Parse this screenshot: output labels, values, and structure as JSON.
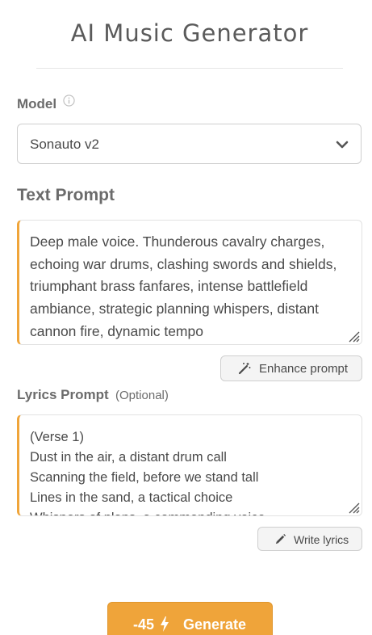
{
  "header": {
    "title": "AI Music Generator"
  },
  "model": {
    "label": "Model",
    "info_icon": "info-circle-icon",
    "selected": "Sonauto v2",
    "dropdown_icon": "chevron-down-icon"
  },
  "text_prompt": {
    "label": "Text Prompt",
    "value": "Deep male voice. Thunderous cavalry charges, echoing war drums, clashing swords and shields, triumphant brass fanfares, intense battlefield ambiance, strategic planning whispers, distant cannon fire, dynamic tempo",
    "enhance_button": "Enhance prompt",
    "enhance_icon": "magic-wand-icon"
  },
  "lyrics_prompt": {
    "label": "Lyrics Prompt",
    "optional": "(Optional)",
    "value": "(Verse 1)\nDust in the air, a distant drum call\nScanning the field, before we stand tall\nLines in the sand, a tactical choice\nWhispers of plans, a commanding voice",
    "write_button": "Write lyrics",
    "write_icon": "pencil-icon"
  },
  "generate": {
    "cost": "-45",
    "cost_icon": "lightning-bolt-icon",
    "label": "Generate"
  },
  "colors": {
    "accent": "#efa43a",
    "text": "#4a4a4a",
    "border": "#cfcfcf"
  }
}
